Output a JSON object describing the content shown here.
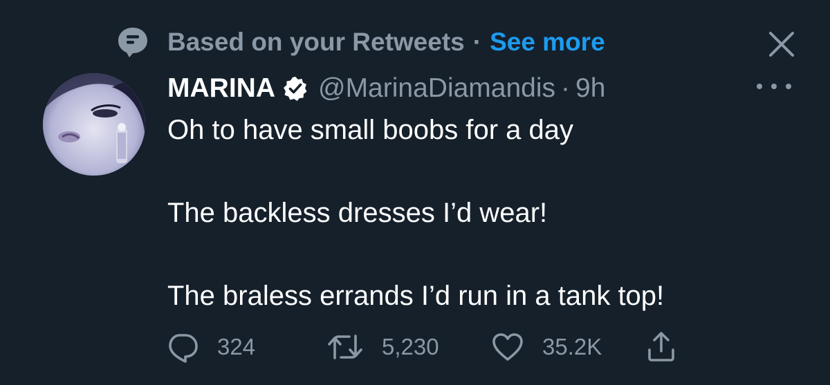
{
  "context": {
    "label": "Based on your Retweets",
    "separator": "·",
    "see_more": "See more",
    "icon": "speech-bubble-icon"
  },
  "tweet": {
    "author_name": "MARINA",
    "verified": true,
    "handle": "@MarinaDiamandis",
    "separator": "·",
    "time": "9h",
    "lines": [
      "Oh to have small boobs for a day",
      "The backless dresses I’d wear!",
      "The braless errands I’d run in a tank top!"
    ]
  },
  "actions": {
    "replies": "324",
    "retweets": "5,230",
    "likes": "35.2K"
  },
  "colors": {
    "background": "#15202b",
    "secondary_text": "#8b98a5",
    "accent": "#1d9bf0",
    "primary_text": "#ffffff"
  }
}
